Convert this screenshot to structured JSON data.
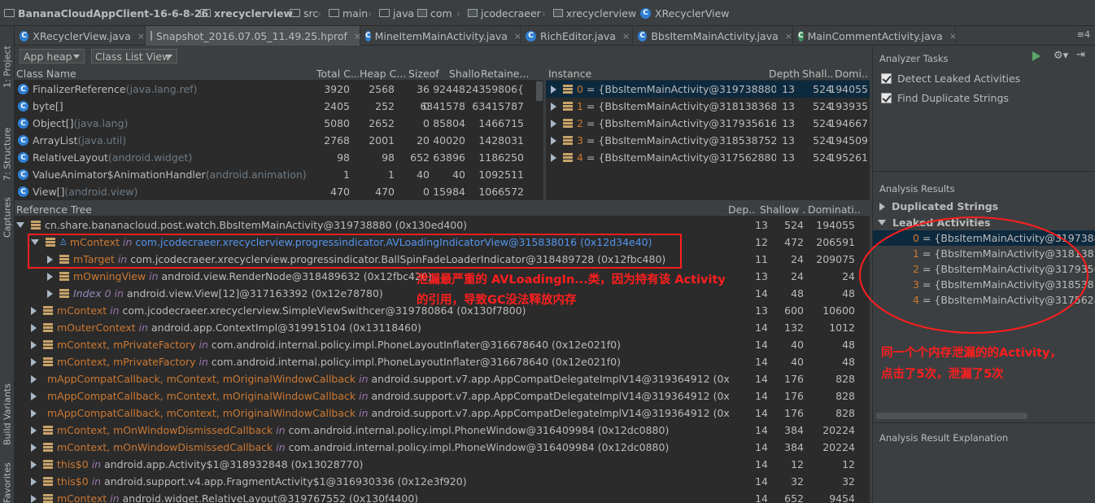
{
  "breadcrumb": [
    "BananaCloudAppClient-16-6-8-26",
    "xrecyclerview",
    "src",
    "main",
    "java",
    "com",
    "jcodecraeer",
    "xrecyclerview",
    "XRecyclerView"
  ],
  "tabs": [
    {
      "label": "XRecyclerView.java",
      "icon": "class-icon",
      "active": false
    },
    {
      "label": "Snapshot_2016.07.05_11.49.25.hprof",
      "icon": "hprof-file-icon",
      "active": true
    },
    {
      "label": "MineItemMainActivity.java",
      "icon": "class-icon",
      "active": false
    },
    {
      "label": "RichEditor.java",
      "icon": "class-icon",
      "active": false
    },
    {
      "label": "BbsItemMainActivity.java",
      "icon": "class-icon",
      "active": false
    },
    {
      "label": "MainCommentActivity.java",
      "icon": "class-green-icon",
      "active": false
    }
  ],
  "tab_overflow": "≡4",
  "left_gutter": {
    "project": "1: Project",
    "structure": "7: Structure",
    "captures": "Captures",
    "build_variants": "Build Variants",
    "favorites": "Favorites"
  },
  "toolbar": {
    "heap": "App heap",
    "view": "Class List View"
  },
  "class_table": {
    "headers": [
      "Class Name",
      "Total C...",
      "Heap C...",
      "Sizeof",
      "Shallow...",
      "Retaine..."
    ],
    "rows": [
      {
        "name": "FinalizerReference",
        "pkg": " (java.lang.ref)",
        "total": "3920",
        "heap": "2568",
        "sizeof": "36",
        "shallow": "92448",
        "retained": "24359806{"
      },
      {
        "name": "byte[]",
        "pkg": "",
        "total": "2405",
        "heap": "252",
        "sizeof": "0",
        "shallow": "6341578",
        "retained": "63415787"
      },
      {
        "name": "Object[]",
        "pkg": " (java.lang)",
        "total": "5080",
        "heap": "2652",
        "sizeof": "0",
        "shallow": "85804",
        "retained": "1466715"
      },
      {
        "name": "ArrayList",
        "pkg": " (java.util)",
        "total": "2768",
        "heap": "2001",
        "sizeof": "20",
        "shallow": "40020",
        "retained": "1428031"
      },
      {
        "name": "RelativeLayout",
        "pkg": " (android.widget)",
        "total": "98",
        "heap": "98",
        "sizeof": "652",
        "shallow": "63896",
        "retained": "1186250"
      },
      {
        "name": "ValueAnimator$AnimationHandler",
        "pkg": " (android.animation)",
        "total": "1",
        "heap": "1",
        "sizeof": "40",
        "shallow": "40",
        "retained": "1092511"
      },
      {
        "name": "View[]",
        "pkg": " (android.view)",
        "total": "470",
        "heap": "470",
        "sizeof": "0",
        "shallow": "15984",
        "retained": "1066572"
      }
    ]
  },
  "instance_table": {
    "headers": [
      "Instance",
      "Depth",
      "Shall...",
      "Domi..."
    ],
    "rows": [
      {
        "label": "0 = {BbsItemMainActivity@319738880 (0",
        "depth": "13",
        "shallow": "524",
        "dominating": "194055"
      },
      {
        "label": "1 = {BbsItemMainActivity@318138368 (0",
        "depth": "13",
        "shallow": "524",
        "dominating": "193935"
      },
      {
        "label": "2 = {BbsItemMainActivity@317935616 (0",
        "depth": "13",
        "shallow": "524",
        "dominating": "194667"
      },
      {
        "label": "3 = {BbsItemMainActivity@318538752 (0",
        "depth": "13",
        "shallow": "524",
        "dominating": "194509"
      },
      {
        "label": "4 = {BbsItemMainActivity@317562880 (0",
        "depth": "13",
        "shallow": "524",
        "dominating": "195261"
      }
    ]
  },
  "ref_tree": {
    "headers": [
      "Reference Tree",
      "Dep...",
      "Shallow ...",
      "Dominati..."
    ],
    "rows": [
      {
        "field": "",
        "intxt": "",
        "ref": "cn.share.bananacloud.post.watch.BbsItemMainActivity@319738880 (0x130ed400)",
        "depth": "13",
        "shallow": "524",
        "dominating": "194055",
        "indent": 0,
        "arrow": "d",
        "icon": "bars"
      },
      {
        "field": "mContext",
        "intxt": " in ",
        "ref": "com.jcodecraeer.xrecyclerview.progressindicator.AVLoadingIndicatorView@315838016 (0x12d34e40)",
        "depth": "12",
        "shallow": "472",
        "dominating": "206591",
        "indent": 1,
        "arrow": "d",
        "icon": "bars-person",
        "blue": true
      },
      {
        "field": "mTarget",
        "intxt": " in ",
        "ref": "com.jcodecraeer.xrecyclerview.progressindicator.BallSpinFadeLoaderIndicator@318489728 (0x12fbc480)",
        "depth": "11",
        "shallow": "24",
        "dominating": "209075",
        "indent": 2,
        "arrow": "r",
        "icon": "bars"
      },
      {
        "field": "mOwningView",
        "intxt": " in ",
        "ref": "android.view.RenderNode@318489632 (0x12fbc420)",
        "depth": "13",
        "shallow": "24",
        "dominating": "24",
        "indent": 2,
        "arrow": "r",
        "icon": "bars"
      },
      {
        "field": "Index",
        "intxt": " 0 in ",
        "ref": "android.view.View[12]@317163392 (0x12e78780)",
        "depth": "14",
        "shallow": "48",
        "dominating": "48",
        "indent": 2,
        "arrow": "r",
        "icon": "bars",
        "italicfield": true
      },
      {
        "field": "mContext",
        "intxt": " in ",
        "ref": "com.jcodecraeer.xrecyclerview.SimpleViewSwithcer@319780864 (0x130f7800)",
        "depth": "13",
        "shallow": "600",
        "dominating": "10600",
        "indent": 1,
        "arrow": "r",
        "icon": "bars"
      },
      {
        "field": "mOuterContext",
        "intxt": " in ",
        "ref": "android.app.ContextImpl@319915104 (0x13118460)",
        "depth": "14",
        "shallow": "132",
        "dominating": "1012",
        "indent": 1,
        "arrow": "r",
        "icon": "bars"
      },
      {
        "field": "mContext, mPrivateFactory",
        "intxt": " in ",
        "ref": "com.android.internal.policy.impl.PhoneLayoutInflater@316678640 (0x12e021f0)",
        "depth": "14",
        "shallow": "40",
        "dominating": "48",
        "indent": 1,
        "arrow": "r",
        "icon": "bars"
      },
      {
        "field": "mContext, mPrivateFactory",
        "intxt": " in ",
        "ref": "com.android.internal.policy.impl.PhoneLayoutInflater@316678640 (0x12e021f0)",
        "depth": "14",
        "shallow": "40",
        "dominating": "48",
        "indent": 1,
        "arrow": "r",
        "icon": "bars"
      },
      {
        "field": "mAppCompatCallback, mContext, mOriginalWindowCallback",
        "intxt": " in ",
        "ref": "android.support.v7.app.AppCompatDelegateImplV14@319364912 (0x13091f",
        "depth": "14",
        "shallow": "176",
        "dominating": "828",
        "indent": 1,
        "arrow": "r",
        "icon": "bars"
      },
      {
        "field": "mAppCompatCallback, mContext, mOriginalWindowCallback",
        "intxt": " in ",
        "ref": "android.support.v7.app.AppCompatDelegateImplV14@319364912 (0x13091f",
        "depth": "14",
        "shallow": "176",
        "dominating": "828",
        "indent": 1,
        "arrow": "r",
        "icon": "bars"
      },
      {
        "field": "mAppCompatCallback, mContext, mOriginalWindowCallback",
        "intxt": " in ",
        "ref": "android.support.v7.app.AppCompatDelegateImplV14@319364912 (0x13091f",
        "depth": "14",
        "shallow": "176",
        "dominating": "828",
        "indent": 1,
        "arrow": "r",
        "icon": "bars"
      },
      {
        "field": "mContext, mOnWindowDismissedCallback",
        "intxt": " in ",
        "ref": "com.android.internal.policy.impl.PhoneWindow@316409984 (0x12dc0880)",
        "depth": "14",
        "shallow": "384",
        "dominating": "20224",
        "indent": 1,
        "arrow": "r",
        "icon": "bars"
      },
      {
        "field": "mContext, mOnWindowDismissedCallback",
        "intxt": " in ",
        "ref": "com.android.internal.policy.impl.PhoneWindow@316409984 (0x12dc0880)",
        "depth": "14",
        "shallow": "384",
        "dominating": "20224",
        "indent": 1,
        "arrow": "r",
        "icon": "bars"
      },
      {
        "field": "this$0",
        "intxt": " in ",
        "ref": "android.app.Activity$1@318932848 (0x13028770)",
        "depth": "14",
        "shallow": "12",
        "dominating": "12",
        "indent": 1,
        "arrow": "r",
        "icon": "bars"
      },
      {
        "field": "this$0",
        "intxt": " in ",
        "ref": "android.support.v4.app.FragmentActivity$1@316930336 (0x12e3f920)",
        "depth": "14",
        "shallow": "32",
        "dominating": "32",
        "indent": 1,
        "arrow": "r",
        "icon": "bars"
      },
      {
        "field": "mContext",
        "intxt": " in ",
        "ref": "android.widget.RelativeLayout@319767552 (0x130f4400)",
        "depth": "14",
        "shallow": "652",
        "dominating": "9454",
        "indent": 1,
        "arrow": "r",
        "icon": "bars"
      }
    ]
  },
  "analyzer": {
    "title": "Analyzer Tasks",
    "tasks": [
      "Detect Leaked Activities",
      "Find Duplicate Strings"
    ],
    "results_title": "Analysis Results",
    "dup_strings": "Duplicated Strings",
    "leaked_activities": "Leaked Activities",
    "leaked_items": [
      "0 = {BbsItemMainActivity@3197388",
      "1 = {BbsItemMainActivity@3181383",
      "2 = {BbsItemMainActivity@3179356",
      "3 = {BbsItemMainActivity@3185387",
      "4 = {BbsItemMainActivity@3175628"
    ],
    "explanation_title": "Analysis Result Explanation"
  },
  "annotations": {
    "leak_line1": "泄漏最严重的 AVLoadingIn...类，因为持有该 Activity",
    "leak_line2": "的引用，导致GC没法释放内存",
    "right_line1": "同一个个内存泄漏的的Activity，",
    "right_line2": "点击了5次，泄漏了5次",
    "color": "#ff1e1e"
  }
}
